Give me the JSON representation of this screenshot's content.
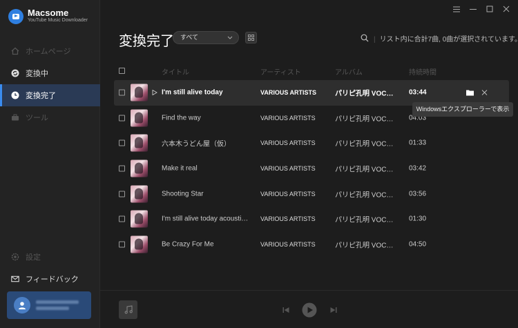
{
  "app": {
    "brand": "Macsome",
    "subtitle": "YouTube Music Downloader"
  },
  "sidebar": {
    "items": [
      {
        "label": "ホームページ",
        "icon": "home-icon",
        "state": "disabled"
      },
      {
        "label": "変換中",
        "icon": "sync-icon",
        "state": "normal"
      },
      {
        "label": "変換完了",
        "icon": "clock-icon",
        "state": "active"
      },
      {
        "label": "ツール",
        "icon": "toolbox-icon",
        "state": "disabled"
      }
    ],
    "bottom_items": [
      {
        "label": "設定",
        "icon": "gear-icon",
        "state": "disabled"
      },
      {
        "label": "フィードバック",
        "icon": "mail-icon",
        "state": "normal"
      }
    ]
  },
  "main": {
    "title": "変換完了",
    "filter_value": "すべて",
    "summary": "リスト内に合計7曲, 0曲が選択されています。",
    "columns": {
      "title": "タイトル",
      "artist": "アーティスト",
      "album": "アルバム",
      "duration": "持続時間"
    },
    "rows": [
      {
        "title": "I'm still alive today",
        "artist": "VARIOUS ARTISTS",
        "album": "パリピ孔明 VOCAL COLLECTION",
        "duration": "03:44"
      },
      {
        "title": "Find the way",
        "artist": "VARIOUS ARTISTS",
        "album": "パリピ孔明 VOCAL COLLECTION",
        "duration": "04:03"
      },
      {
        "title": "六本木うどん屋（仮）",
        "artist": "VARIOUS ARTISTS",
        "album": "パリピ孔明 VOCAL COLLECTION",
        "duration": "01:33"
      },
      {
        "title": "Make it real",
        "artist": "VARIOUS ARTISTS",
        "album": "パリピ孔明 VOCAL COLLECTION",
        "duration": "03:42"
      },
      {
        "title": "Shooting Star",
        "artist": "VARIOUS ARTISTS",
        "album": "パリピ孔明 VOCAL COLLECTION",
        "duration": "03:56"
      },
      {
        "title": "I'm still alive today acoustic ver.",
        "artist": "VARIOUS ARTISTS",
        "album": "パリピ孔明 VOCAL COLLECTION",
        "duration": "01:30"
      },
      {
        "title": "Be Crazy For Me",
        "artist": "VARIOUS ARTISTS",
        "album": "パリピ孔明 VOCAL COLLECTION",
        "duration": "04:50"
      }
    ],
    "tooltip": "Windowsエクスプローラーで表示"
  },
  "colors": {
    "accent": "#3a8cf0",
    "sidebar_active": "#2a3a55",
    "background": "#1d1d1d"
  }
}
